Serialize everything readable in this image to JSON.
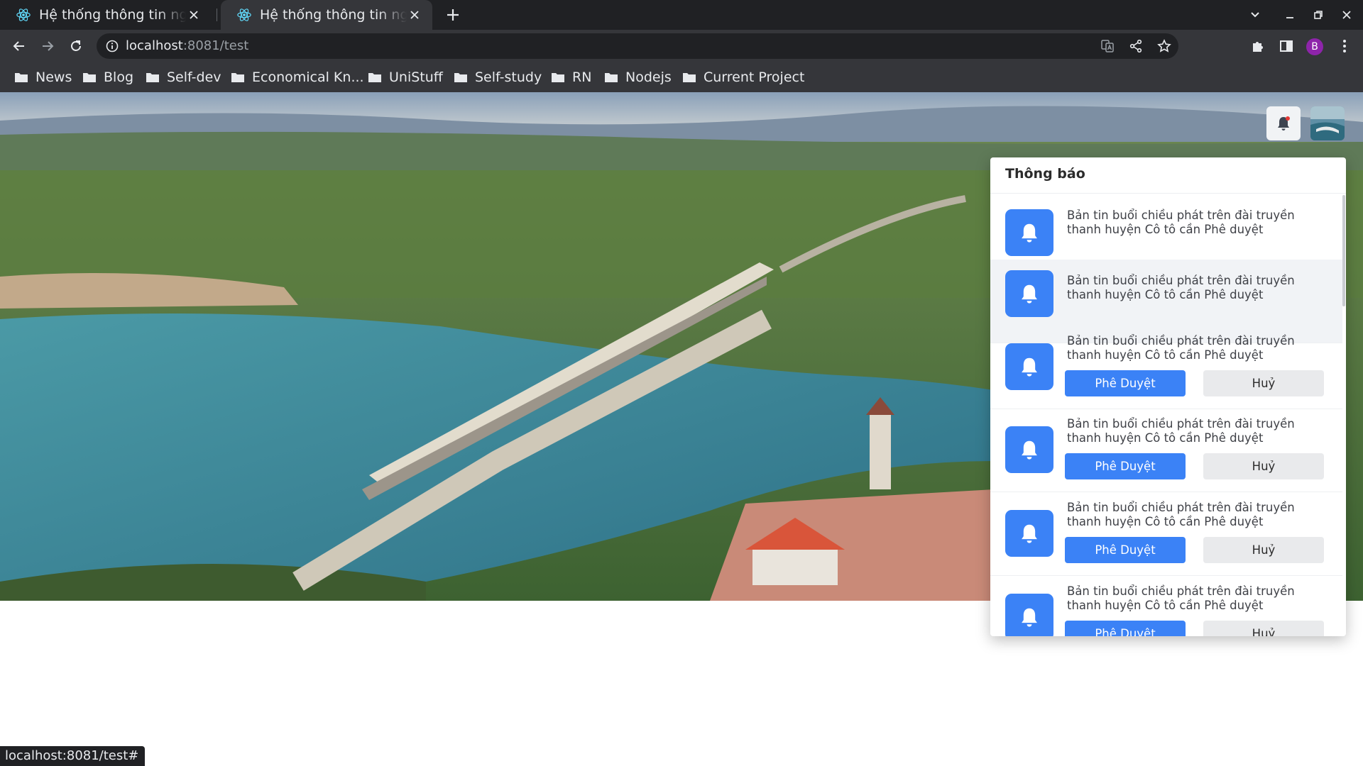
{
  "browser": {
    "tabs": [
      {
        "title": "Hệ thống thông tin nguồn",
        "favicon": "react-logo-icon",
        "active": false
      },
      {
        "title": "Hệ thống thông tin nguồn",
        "favicon": "react-logo-icon",
        "active": true
      }
    ],
    "url": {
      "host": "localhost",
      "rest": ":8081/test"
    },
    "profile_initial": "B",
    "bookmarks": [
      "News",
      "Blog",
      "Self-dev",
      "Economical Kn...",
      "UniStuff",
      "Self-study",
      "RN",
      "Nodejs",
      "Current Project"
    ],
    "status_url": "localhost:8081/test#"
  },
  "header": {
    "bell_icon": "bell-icon",
    "has_unread": true,
    "avatar": "user-avatar-thumbnail"
  },
  "notifications": {
    "title": "Thông báo",
    "items": [
      {
        "text": "Bản tin buổi chiều phát trên đài truyền thanh huyện Cô tô cần Phê duyệt",
        "hovered": false
      },
      {
        "text": "Bản tin buổi chiều phát trên đài truyền thanh huyện Cô tô cần Phê duyệt",
        "hovered": true
      },
      {
        "text": "Bản tin buổi chiều phát trên đài truyền thanh huyện Cô tô cần Phê duyệt",
        "approve": "Phê Duyệt",
        "cancel": "Huỷ"
      },
      {
        "text": "Bản tin buổi chiều phát trên đài truyền thanh huyện Cô tô cần Phê duyệt",
        "approve": "Phê Duyệt",
        "cancel": "Huỷ"
      },
      {
        "text": "Bản tin buổi chiều phát trên đài truyền thanh huyện Cô tô cần Phê duyệt",
        "approve": "Phê Duyệt",
        "cancel": "Huỷ"
      },
      {
        "text": "Bản tin buổi chiều phát trên đài truyền thanh huyện Cô tô cần Phê duyệt",
        "approve": "Phê Duyệt",
        "cancel": "Huỷ"
      }
    ]
  },
  "colors": {
    "primary": "#3b82f6",
    "chrome_dark": "#202124",
    "chrome_toolbar": "#35363a",
    "unread_dot": "#e53935"
  }
}
